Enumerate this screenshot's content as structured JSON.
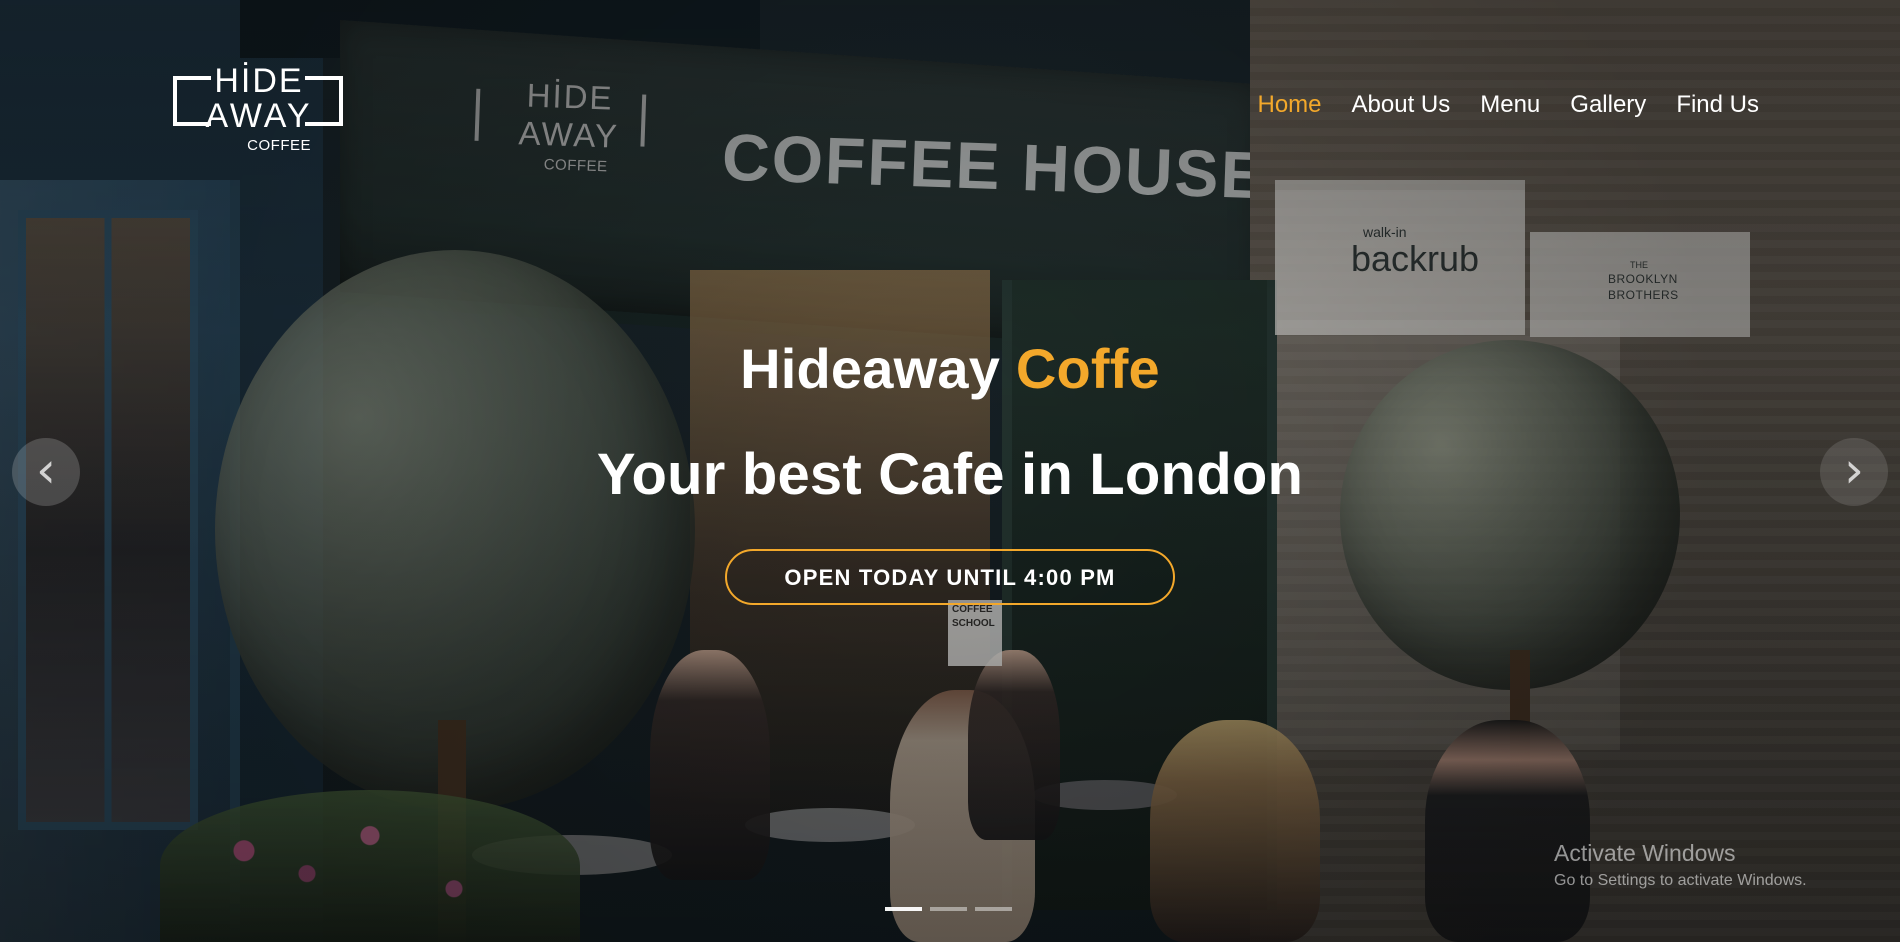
{
  "background": {
    "signage_logo": {
      "line1": "HİDE",
      "line2": "AWAY",
      "line3": "COFFEE"
    },
    "shop_sign": "COFFEE HOUSE",
    "neighbor_sign_1": {
      "line1": "walk-in",
      "line2": "backrub"
    },
    "neighbor_sign_2": {
      "line1": "THE",
      "line2": "BROOKLYN",
      "line3": "BROTHERS"
    },
    "window_sign": {
      "line1": "COFFEE",
      "line2": "SCHOOL"
    }
  },
  "brand": {
    "logo_top": "HİDE",
    "logo_mid": "AWAY",
    "logo_bottom": "COFFEE"
  },
  "nav": {
    "items": [
      {
        "label": "Home",
        "active": true
      },
      {
        "label": "About Us",
        "active": false
      },
      {
        "label": "Menu",
        "active": false
      },
      {
        "label": "Gallery",
        "active": false
      },
      {
        "label": "Find Us",
        "active": false
      }
    ]
  },
  "hero": {
    "title_prefix": "Hideaway",
    "title_accent": "Coffe",
    "subtitle": "Your best Cafe in London",
    "cta_label": "OPEN TODAY UNTIL 4:00 PM"
  },
  "carousel": {
    "left_arrow": "‹",
    "right_arrow": "›",
    "slides": 3,
    "active_slide": 1
  },
  "system_watermark": {
    "title": "Activate Windows",
    "subtitle": "Go to Settings to activate Windows."
  },
  "colors": {
    "accent": "#f3a82b",
    "text": "#ffffff"
  },
  "icons": {
    "left_arrow": "chevron-left-icon",
    "right_arrow": "chevron-right-icon"
  }
}
